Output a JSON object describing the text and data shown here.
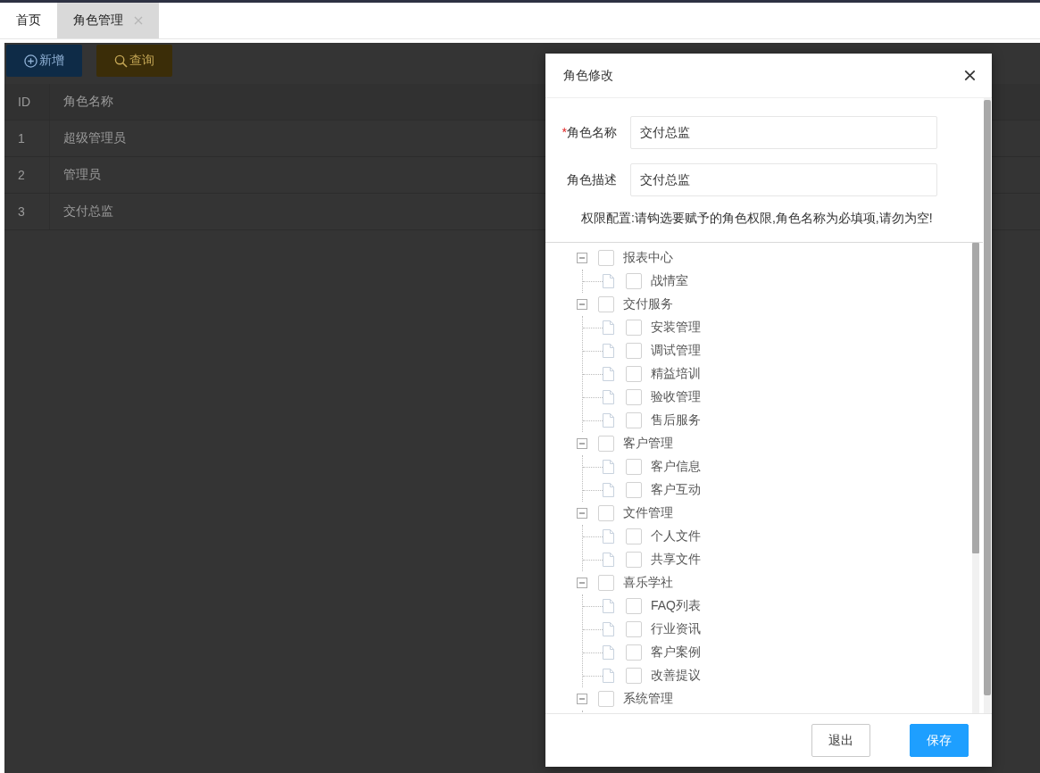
{
  "tabs": [
    {
      "label": "首页",
      "selected": false,
      "closable": false
    },
    {
      "label": "角色管理",
      "selected": true,
      "closable": true
    }
  ],
  "toolbar": [
    {
      "label": "新增",
      "kind": "add"
    },
    {
      "label": "查询",
      "kind": "search"
    }
  ],
  "table": {
    "columns": [
      "ID",
      "角色名称"
    ],
    "rows": [
      [
        "1",
        "超级管理员"
      ],
      [
        "2",
        "管理员"
      ],
      [
        "3",
        "交付总监"
      ]
    ]
  },
  "dialog": {
    "title": "角色修改",
    "fields": [
      {
        "label": "角色名称",
        "required_mark": "*",
        "value": "交付总监"
      },
      {
        "label": "角色描述",
        "value": "交付总监"
      }
    ],
    "note": "权限配置:请钩选要赋予的角色权限,角色名称为必填项,请勿为空!",
    "tree": [
      {
        "label": "报表中心",
        "expanded": true,
        "checked": false,
        "children": [
          {
            "label": "战情室",
            "checked": false
          }
        ]
      },
      {
        "label": "交付服务",
        "expanded": true,
        "checked": false,
        "children": [
          {
            "label": "安装管理",
            "checked": false
          },
          {
            "label": "调试管理",
            "checked": false
          },
          {
            "label": "精益培训",
            "checked": false
          },
          {
            "label": "验收管理",
            "checked": false
          },
          {
            "label": "售后服务",
            "checked": false
          }
        ]
      },
      {
        "label": "客户管理",
        "expanded": true,
        "checked": false,
        "children": [
          {
            "label": "客户信息",
            "checked": false
          },
          {
            "label": "客户互动",
            "checked": false
          }
        ]
      },
      {
        "label": "文件管理",
        "expanded": true,
        "checked": false,
        "children": [
          {
            "label": "个人文件",
            "checked": false
          },
          {
            "label": "共享文件",
            "checked": false
          }
        ]
      },
      {
        "label": "喜乐学社",
        "expanded": true,
        "checked": false,
        "children": [
          {
            "label": "FAQ列表",
            "checked": false
          },
          {
            "label": "行业资讯",
            "checked": false
          },
          {
            "label": "客户案例",
            "checked": false
          },
          {
            "label": "改善提议",
            "checked": false
          }
        ]
      },
      {
        "label": "系统管理",
        "expanded": true,
        "checked": false
      }
    ],
    "buttons": [
      {
        "label": "退出",
        "kind": "secondary"
      },
      {
        "label": "保存",
        "kind": "primary"
      }
    ]
  }
}
